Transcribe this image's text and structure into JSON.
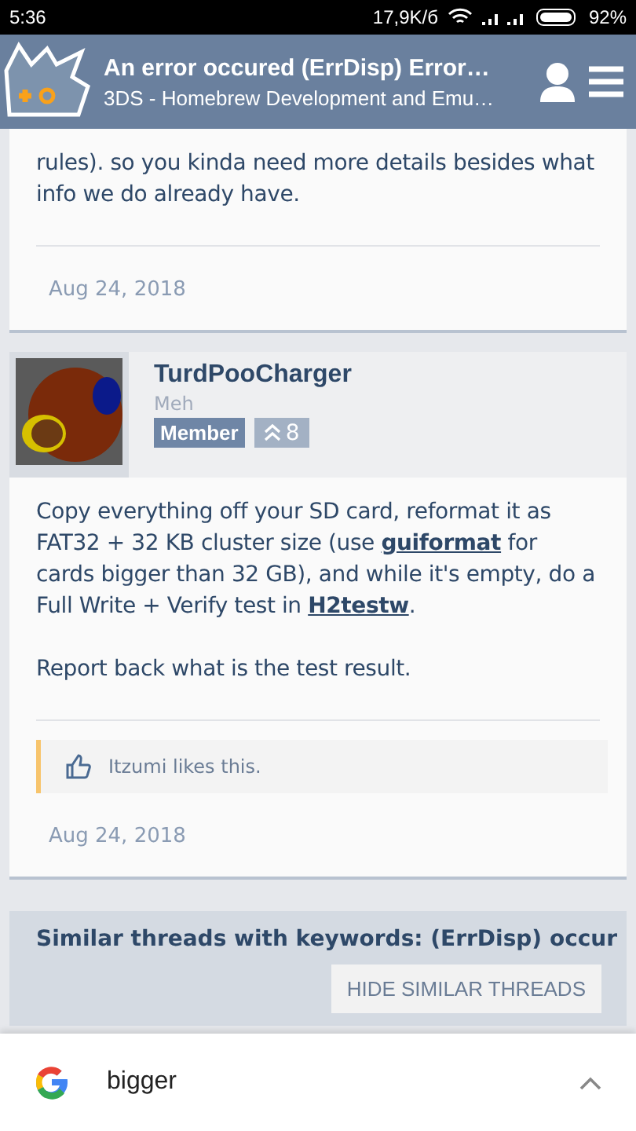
{
  "status_bar": {
    "time": "5:36",
    "speed": "17,9K/б",
    "battery": "92%"
  },
  "header": {
    "title": "An error occured (ErrDisp) Error…",
    "subtitle": "3DS - Homebrew Development and Emu…"
  },
  "posts": [
    {
      "kind": "tail",
      "body": [
        "rules). so you kinda need more details besides what info we do already have."
      ],
      "date": "Aug 24, 2018"
    },
    {
      "kind": "full",
      "author": "TurdPooCharger",
      "user_title": "Meh",
      "role": "Member",
      "trophies": "8",
      "body": [
        "Copy everything off your SD card, reformat it as FAT32 + 32 KB cluster size (use **guiformat** for cards bigger than 32 GB), and while it's empty, do a Full Write + Verify test in **H2testw**.",
        "Report back what is the test result."
      ],
      "likes": "Itzumi likes this.",
      "date": "Aug 24, 2018"
    }
  ],
  "similar": {
    "title": "Similar threads with keywords: (ErrDisp) occur",
    "button": "HIDE SIMILAR THREADS"
  },
  "search_bar": {
    "query": "bigger"
  }
}
